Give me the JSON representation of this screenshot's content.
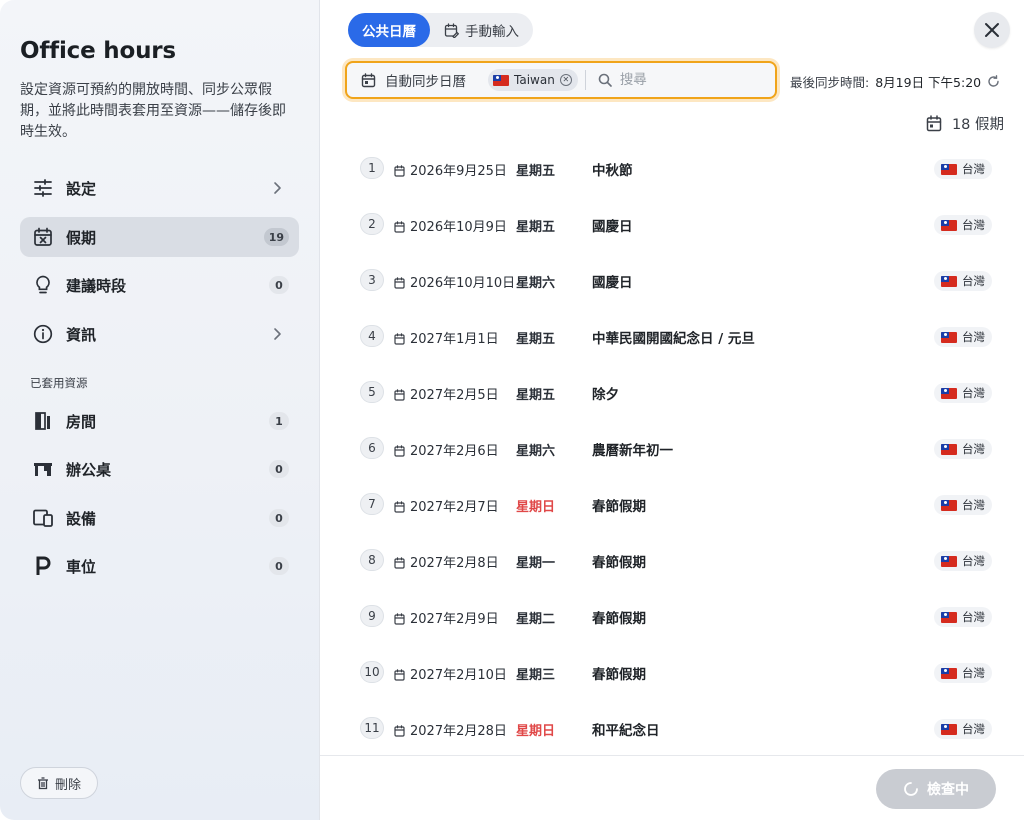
{
  "sidebar": {
    "title": "Office hours",
    "description": "設定資源可預約的開放時間、同步公眾假期，並將此時間表套用至資源——儲存後即時生效。",
    "items": [
      {
        "label": "設定",
        "badge": null
      },
      {
        "label": "假期",
        "badge": "19"
      },
      {
        "label": "建議時段",
        "badge": "0"
      },
      {
        "label": "資訊",
        "badge": null
      }
    ],
    "section_label": "已套用資源",
    "resources": [
      {
        "label": "房間",
        "badge": "1"
      },
      {
        "label": "辦公桌",
        "badge": "0"
      },
      {
        "label": "設備",
        "badge": "0"
      },
      {
        "label": "車位",
        "badge": "0"
      }
    ],
    "delete_label": "刪除"
  },
  "tabs": {
    "public_calendar": "公共日曆",
    "manual_input": "手動輸入"
  },
  "sync": {
    "auto_sync_label": "自動同步日曆",
    "country_chip": "Taiwan",
    "search_placeholder": "搜尋",
    "last_sync_label": "最後同步時間:",
    "last_sync_value": "8月19日 下午5:20"
  },
  "holiday_count": "18 假期",
  "holidays": [
    {
      "num": "1",
      "date": "2026年9月25日",
      "dow": "星期五",
      "name": "中秋節",
      "region": "台灣"
    },
    {
      "num": "2",
      "date": "2026年10月9日",
      "dow": "星期五",
      "name": "國慶日",
      "region": "台灣"
    },
    {
      "num": "3",
      "date": "2026年10月10日",
      "dow": "星期六",
      "name": "國慶日",
      "region": "台灣"
    },
    {
      "num": "4",
      "date": "2027年1月1日",
      "dow": "星期五",
      "name": "中華民國開國紀念日 / 元旦",
      "region": "台灣"
    },
    {
      "num": "5",
      "date": "2027年2月5日",
      "dow": "星期五",
      "name": "除夕",
      "region": "台灣"
    },
    {
      "num": "6",
      "date": "2027年2月6日",
      "dow": "星期六",
      "name": "農曆新年初一",
      "region": "台灣"
    },
    {
      "num": "7",
      "date": "2027年2月7日",
      "dow": "星期日",
      "name": "春節假期",
      "region": "台灣"
    },
    {
      "num": "8",
      "date": "2027年2月8日",
      "dow": "星期一",
      "name": "春節假期",
      "region": "台灣"
    },
    {
      "num": "9",
      "date": "2027年2月9日",
      "dow": "星期二",
      "name": "春節假期",
      "region": "台灣"
    },
    {
      "num": "10",
      "date": "2027年2月10日",
      "dow": "星期三",
      "name": "春節假期",
      "region": "台灣"
    },
    {
      "num": "11",
      "date": "2027年2月28日",
      "dow": "星期日",
      "name": "和平紀念日",
      "region": "台灣"
    }
  ],
  "footer": {
    "check_label": "檢查中"
  },
  "colors": {
    "accent": "#2a6ae8",
    "highlight_border": "#f0a41a",
    "sunday": "#e04848",
    "disabled_button": "#c9ccd2"
  }
}
